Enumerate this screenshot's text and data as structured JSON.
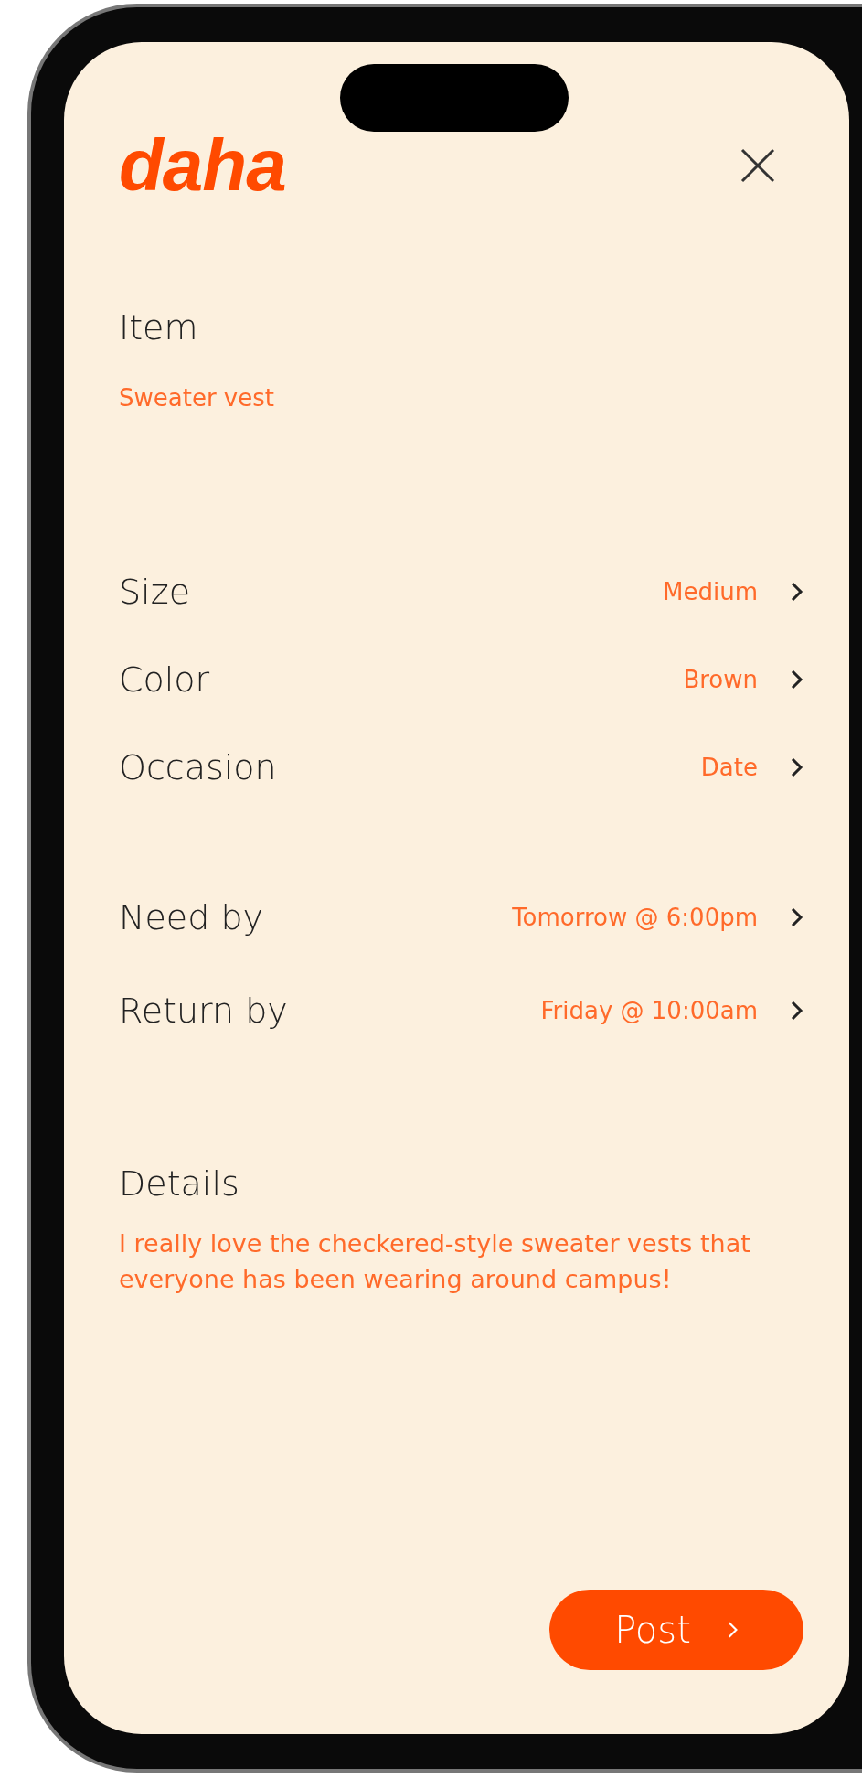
{
  "logo": "daha",
  "item": {
    "label": "Item",
    "value": "Sweater vest"
  },
  "attributes": [
    {
      "label": "Size",
      "value": "Medium"
    },
    {
      "label": "Color",
      "value": "Brown"
    },
    {
      "label": "Occasion",
      "value": "Date"
    }
  ],
  "timing": [
    {
      "label": "Need by",
      "value": "Tomorrow @ 6:00pm"
    },
    {
      "label": "Return by",
      "value": "Friday @ 10:00am"
    }
  ],
  "details": {
    "label": "Details",
    "text": "I really love the checkered-style sweater vests that everyone has been wearing around campus!"
  },
  "post_button": {
    "label": "Post"
  }
}
